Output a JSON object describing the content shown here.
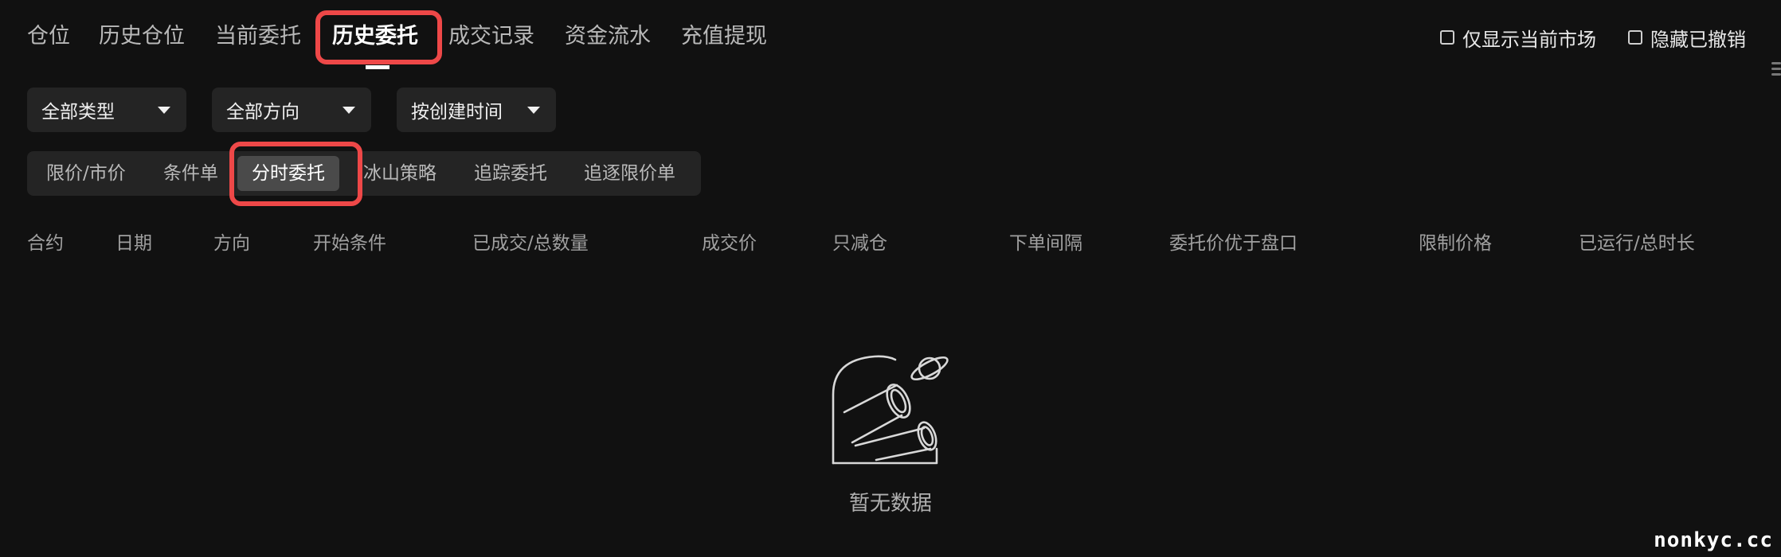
{
  "tabs": [
    {
      "label": "仓位"
    },
    {
      "label": "历史仓位"
    },
    {
      "label": "当前委托"
    },
    {
      "label": "历史委托",
      "active": true
    },
    {
      "label": "成交记录"
    },
    {
      "label": "资金流水"
    },
    {
      "label": "充值提现"
    }
  ],
  "options": {
    "current_market_only": "仅显示当前市场",
    "hide_cancelled": "隐藏已撤销"
  },
  "filters": {
    "type": "全部类型",
    "direction": "全部方向",
    "sort": "按创建时间"
  },
  "order_types": [
    {
      "label": "限价/市价"
    },
    {
      "label": "条件单"
    },
    {
      "label": "分时委托",
      "active": true
    },
    {
      "label": "冰山策略"
    },
    {
      "label": "追踪委托"
    },
    {
      "label": "追逐限价单"
    }
  ],
  "table": {
    "columns": [
      "合约",
      "日期",
      "方向",
      "开始条件",
      "已成交/总数量",
      "成交价",
      "只减仓",
      "下单间隔",
      "委托价优于盘口",
      "限制价格",
      "已运行/总时长"
    ]
  },
  "empty_state": {
    "text": "暂无数据",
    "icon": "telescope-planet-icon"
  },
  "watermark": "nonkyc.cc",
  "colors": {
    "background": "#111111",
    "highlight": "#ee4848",
    "control_bg": "#242424",
    "active_segment": "#4a4a4a"
  }
}
